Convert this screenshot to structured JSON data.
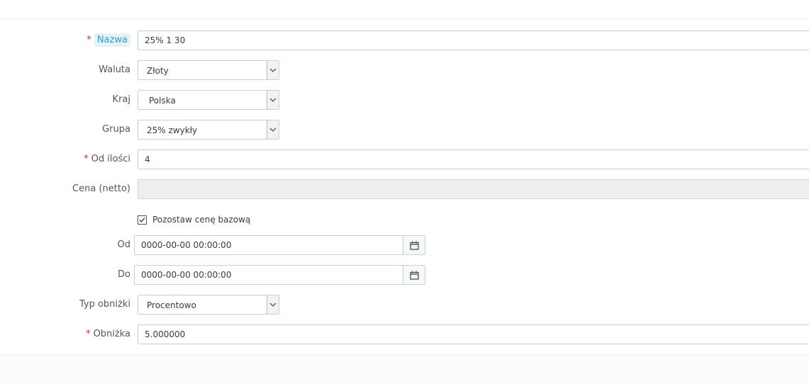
{
  "form": {
    "name": {
      "label": "Nazwa",
      "value": "25% 1 30",
      "required": true
    },
    "currency": {
      "label": "Waluta",
      "value": "Złoty"
    },
    "country": {
      "label": "Kraj",
      "value": "Polska"
    },
    "group": {
      "label": "Grupa",
      "value": "25% zwykły"
    },
    "from_quantity": {
      "label": "Od ilości",
      "value": "4",
      "required": true
    },
    "price_net": {
      "label": "Cena (netto)",
      "value": ""
    },
    "keep_base_price": {
      "label": "Pozostaw cenę bazową",
      "checked": true
    },
    "date_from": {
      "label": "Od",
      "value": "0000-00-00 00:00:00"
    },
    "date_to": {
      "label": "Do",
      "value": "0000-00-00 00:00:00"
    },
    "reduction_type": {
      "label": "Typ obniżki",
      "value": "Procentowo"
    },
    "reduction": {
      "label": "Obniżka",
      "value": "5.000000",
      "required": true
    },
    "required_marker": "*"
  },
  "colors": {
    "required": "#e32b2b",
    "highlight": "#25a3cf"
  },
  "icons": {
    "select_arrow": "chevron-down-icon",
    "calendar": "calendar-icon",
    "checkbox": "check-icon"
  }
}
